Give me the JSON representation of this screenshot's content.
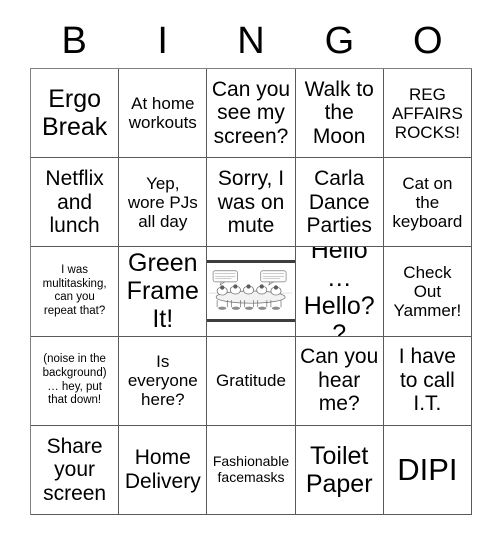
{
  "header": {
    "letters": [
      "B",
      "I",
      "N",
      "G",
      "O"
    ]
  },
  "grid": {
    "rows": [
      [
        {
          "text": "Ergo\nBreak",
          "size": "xl"
        },
        {
          "text": "At home\nworkouts",
          "size": "md"
        },
        {
          "text": "Can you\nsee my\nscreen?",
          "size": "lg"
        },
        {
          "text": "Walk to\nthe\nMoon",
          "size": "lg"
        },
        {
          "text": "REG\nAFFAIRS\nROCKS!",
          "size": "md"
        }
      ],
      [
        {
          "text": "Netflix\nand\nlunch",
          "size": "lg"
        },
        {
          "text": "Yep,\nwore PJs\nall day",
          "size": "md"
        },
        {
          "text": "Sorry, I\nwas on\nmute",
          "size": "lg"
        },
        {
          "text": "Carla\nDance\nParties",
          "size": "lg"
        },
        {
          "text": "Cat on\nthe\nkeyboard",
          "size": "md"
        }
      ],
      [
        {
          "text": "I was\nmultitasking,\ncan you\nrepeat that?",
          "size": "xs"
        },
        {
          "text": "Green\nFrame\nIt!",
          "size": "xl"
        },
        {
          "type": "image",
          "alt": "cartoon-conference-table"
        },
        {
          "text": "Hello…\nHello??",
          "size": "xl"
        },
        {
          "text": "Check\nOut\nYammer!",
          "size": "md"
        }
      ],
      [
        {
          "text": "(noise in the\nbackground)\n… hey, put\nthat down!",
          "size": "xs"
        },
        {
          "text": "Is\neveryone\nhere?",
          "size": "md"
        },
        {
          "text": "Gratitude",
          "size": "md"
        },
        {
          "text": "Can you\nhear\nme?",
          "size": "lg"
        },
        {
          "text": "I have\nto call\nI.T.",
          "size": "lg"
        }
      ],
      [
        {
          "text": "Share\nyour\nscreen",
          "size": "lg"
        },
        {
          "text": "Home\nDelivery",
          "size": "lg"
        },
        {
          "text": "Fashionable\nfacemasks",
          "size": "sm"
        },
        {
          "text": "Toilet\nPaper",
          "size": "xl"
        },
        {
          "text": "DIPI",
          "size": "xxl"
        }
      ]
    ]
  }
}
